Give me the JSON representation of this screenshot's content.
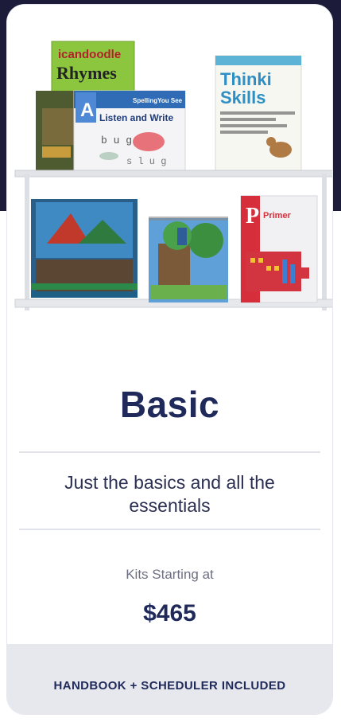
{
  "card": {
    "title": "Basic",
    "subtitle": "Just the basics and all the essentials",
    "kits_label": "Kits Starting at",
    "price": "$465",
    "footer_note": "HANDBOOK + SCHEDULER INCLUDED"
  },
  "books": {
    "doodle_title_1": "icandoodle",
    "doodle_title_2": "Rhymes",
    "listen_title": "Listen and Write",
    "listen_badge": "A",
    "listen_brand": "SpellingYou See",
    "thinking_title": "Thinking Skills",
    "primer_title": "Primer"
  },
  "colors": {
    "title": "#1f2a5a",
    "footer_bg": "#e7e8ed",
    "page_bg_dark": "#1c1c3a"
  }
}
